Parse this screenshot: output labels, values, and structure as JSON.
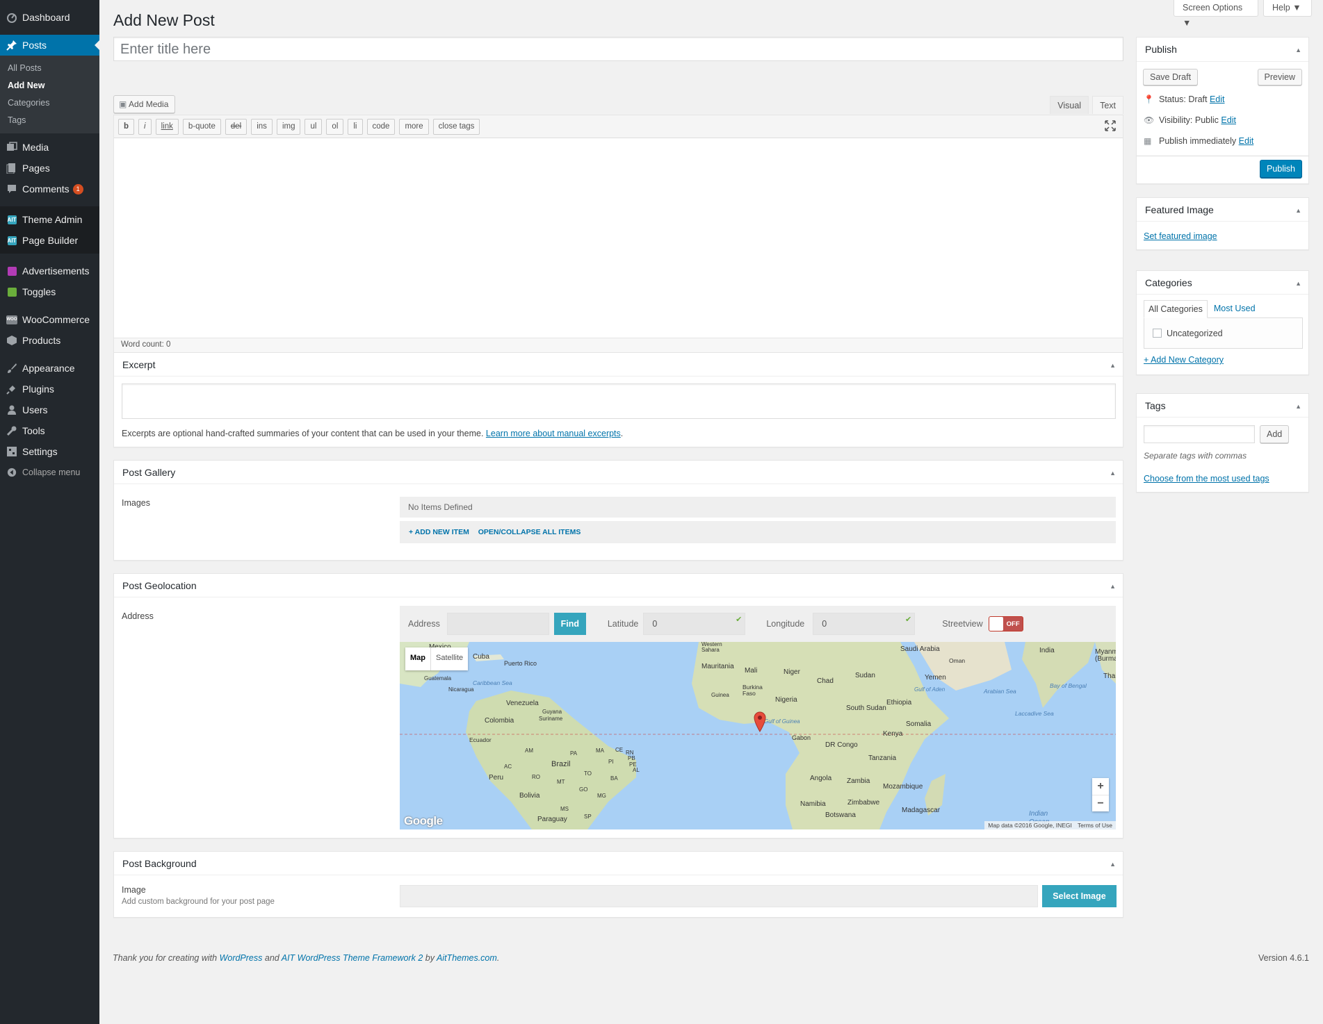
{
  "sidebar": {
    "dashboard": "Dashboard",
    "posts": "Posts",
    "posts_sub": [
      "All Posts",
      "Add New",
      "Categories",
      "Tags"
    ],
    "media": "Media",
    "pages": "Pages",
    "comments": "Comments",
    "comments_count": "1",
    "theme_admin": "Theme Admin",
    "page_builder": "Page Builder",
    "advertisements": "Advertisements",
    "toggles": "Toggles",
    "woocommerce": "WooCommerce",
    "products": "Products",
    "appearance": "Appearance",
    "plugins": "Plugins",
    "users": "Users",
    "tools": "Tools",
    "settings": "Settings",
    "collapse": "Collapse menu",
    "ait_icon": "AIT",
    "woo_icon": "WOO"
  },
  "header": {
    "screen_options": "Screen Options",
    "help": "Help",
    "page_title": "Add New Post"
  },
  "editor": {
    "title_placeholder": "Enter title here",
    "add_media": "Add Media",
    "tab_visual": "Visual",
    "tab_text": "Text",
    "quicktags": [
      "b",
      "i",
      "link",
      "b-quote",
      "del",
      "ins",
      "img",
      "ul",
      "ol",
      "li",
      "code",
      "more",
      "close tags"
    ],
    "word_count": "Word count: 0"
  },
  "excerpt": {
    "title": "Excerpt",
    "help_text": "Excerpts are optional hand-crafted summaries of your content that can be used in your theme.",
    "help_link": "Learn more about manual excerpts",
    "help_end": "."
  },
  "gallery": {
    "title": "Post Gallery",
    "label": "Images",
    "empty": "No Items Defined",
    "add_item": "+ ADD NEW ITEM",
    "toggle_all": "OPEN/COLLAPSE ALL ITEMS"
  },
  "geolocation": {
    "title": "Post Geolocation",
    "label": "Address",
    "address_label": "Address",
    "find": "Find",
    "latitude_label": "Latitude",
    "latitude": "0",
    "longitude_label": "Longitude",
    "longitude": "0",
    "streetview_label": "Streetview",
    "streetview_state": "OFF",
    "map_tab": "Map",
    "satellite_tab": "Satellite",
    "map_data": "Map data ©2016 Google, INEGI",
    "terms": "Terms of Use",
    "google": "Google",
    "zoom_in": "+",
    "zoom_out": "−",
    "labels": {
      "mexico": "Mexico",
      "cuba": "Cuba",
      "puerto_rico": "Puerto Rico",
      "guatemala": "Guatemala",
      "caribbean": "Caribbean Sea",
      "nicaragua": "Nicaragua",
      "venezuela": "Venezuela",
      "guyana": "Guyana",
      "suriname": "Suriname",
      "colombia": "Colombia",
      "ecuador": "Ecuador",
      "peru": "Peru",
      "brazil": "Brazil",
      "bolivia": "Bolivia",
      "paraguay": "Paraguay",
      "am": "AM",
      "pa": "PA",
      "ma": "MA",
      "ce": "CE",
      "rn": "RN",
      "pb": "PB",
      "pe": "PE",
      "pi": "PI",
      "ac": "AC",
      "ro": "RO",
      "to": "TO",
      "ba": "BA",
      "al": "AL",
      "mt": "MT",
      "go": "GO",
      "mg": "MG",
      "ms": "MS",
      "sp": "SP",
      "western_sahara": "Western Sahara",
      "mauritania": "Mauritania",
      "mali": "Mali",
      "niger": "Niger",
      "chad": "Chad",
      "sudan": "Sudan",
      "burkina": "Burkina Faso",
      "guinea": "Guinea",
      "nigeria": "Nigeria",
      "gulf": "Gulf of Guinea",
      "south_sudan": "South Sudan",
      "ethiopia": "Ethiopia",
      "somalia": "Somalia",
      "kenya": "Kenya",
      "gabon": "Gabon",
      "drc": "DR Congo",
      "tanzania": "Tanzania",
      "angola": "Angola",
      "zambia": "Zambia",
      "mozambique": "Mozambique",
      "namibia": "Namibia",
      "zimbabwe": "Zimbabwe",
      "botswana": "Botswana",
      "madagascar": "Madagascar",
      "saudi": "Saudi Arabia",
      "oman": "Oman",
      "yemen": "Yemen",
      "gulf_aden": "Gulf of Aden",
      "arabian_sea": "Arabian Sea",
      "india": "India",
      "myanmar": "Myanmar (Burma)",
      "thai": "Thai",
      "bay_bengal": "Bay of Bengal",
      "laccadive": "Laccadive Sea",
      "indian_ocean": "Indian Ocean"
    }
  },
  "background": {
    "title": "Post Background",
    "label": "Image",
    "desc": "Add custom background for your post page",
    "select": "Select Image"
  },
  "publish": {
    "title": "Publish",
    "save_draft": "Save Draft",
    "preview": "Preview",
    "status_label": "Status: Draft",
    "visibility_label": "Visibility: Public",
    "schedule_label": "Publish immediately",
    "edit": "Edit",
    "publish_btn": "Publish"
  },
  "featured": {
    "title": "Featured Image",
    "link": "Set featured image"
  },
  "categories": {
    "title": "Categories",
    "tab_all": "All Categories",
    "tab_most": "Most Used",
    "item": "Uncategorized",
    "add_new": "+ Add New Category"
  },
  "tags": {
    "title": "Tags",
    "add": "Add",
    "hint": "Separate tags with commas",
    "choose": "Choose from the most used tags"
  },
  "footer": {
    "thanks": "Thank you for creating with",
    "wp": "WordPress",
    "and": "and",
    "ait": "AIT WordPress Theme Framework 2",
    "by": "by",
    "ait_site": "AitThemes.com",
    "dot": ".",
    "version": "Version 4.6.1"
  },
  "colors": {
    "accent": "#0073aa",
    "ait_button": "#35a5bd",
    "sidebar": "#23282d",
    "badge": "#d54e21"
  }
}
